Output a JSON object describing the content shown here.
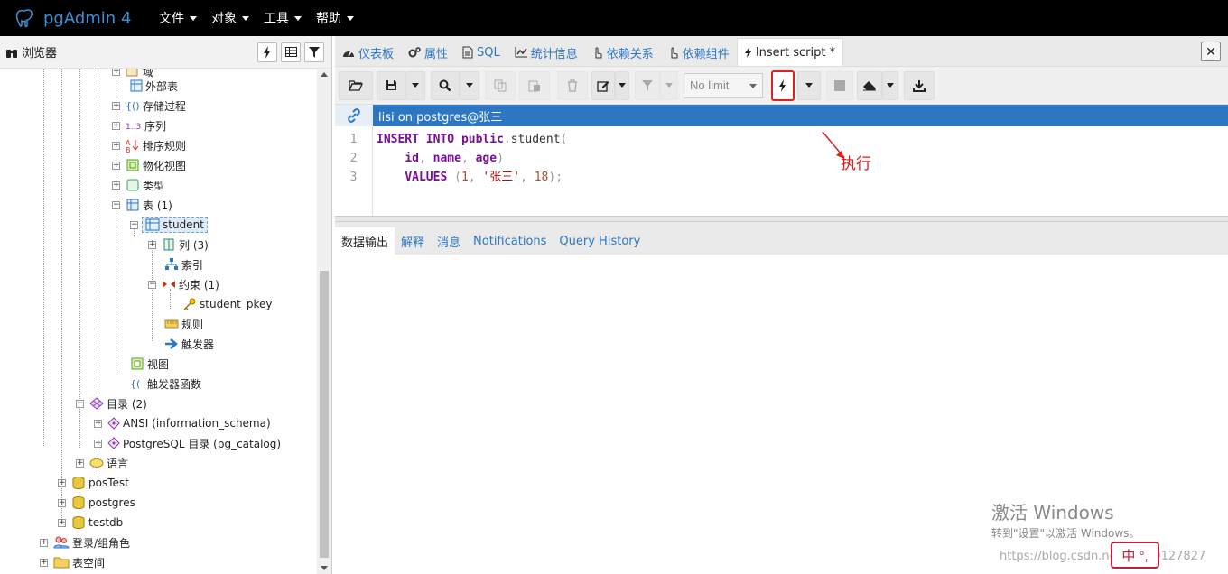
{
  "app": {
    "name": "pgAdmin 4"
  },
  "menu": [
    {
      "label": "文件"
    },
    {
      "label": "对象"
    },
    {
      "label": "工具"
    },
    {
      "label": "帮助"
    }
  ],
  "browser": {
    "title": "浏览器"
  },
  "tree": [
    {
      "label": "域"
    },
    {
      "label": "外部表"
    },
    {
      "label": "存储过程"
    },
    {
      "label": "序列"
    },
    {
      "label": "排序规则"
    },
    {
      "label": "物化视图"
    },
    {
      "label": "类型"
    },
    {
      "label": "表 (1)"
    },
    {
      "label": "student"
    },
    {
      "label": "列 (3)"
    },
    {
      "label": "索引"
    },
    {
      "label": "约束 (1)"
    },
    {
      "label": "student_pkey"
    },
    {
      "label": "规则"
    },
    {
      "label": "触发器"
    },
    {
      "label": "视图"
    },
    {
      "label": "触发器函数"
    },
    {
      "label": "目录 (2)"
    },
    {
      "label": "ANSI (information_schema)"
    },
    {
      "label": "PostgreSQL 目录 (pg_catalog)"
    },
    {
      "label": "语言"
    },
    {
      "label": "posTest"
    },
    {
      "label": "postgres"
    },
    {
      "label": "testdb"
    },
    {
      "label": "登录/组角色"
    },
    {
      "label": "表空间"
    }
  ],
  "tabs": [
    {
      "label": "仪表板"
    },
    {
      "label": "属性"
    },
    {
      "label": "SQL"
    },
    {
      "label": "统计信息"
    },
    {
      "label": "依赖关系"
    },
    {
      "label": "依赖组件"
    },
    {
      "label": "Insert script *"
    }
  ],
  "toolbar": {
    "limit": "No limit"
  },
  "connection": {
    "label": "lisi on postgres@张三"
  },
  "editor": {
    "line_numbers": [
      "1",
      "2",
      "3"
    ],
    "lines": [
      "INSERT INTO public.student(",
      "    id, name, age)",
      "    VALUES (1, '张三', 18);"
    ]
  },
  "annotation": "执行",
  "result_tabs": [
    {
      "label": "数据输出"
    },
    {
      "label": "解释"
    },
    {
      "label": "消息"
    },
    {
      "label": "Notifications"
    },
    {
      "label": "Query History"
    }
  ],
  "watermark": {
    "line1": "激活 Windows",
    "line2": "转到\"设置\"以激活 Windows。",
    "line3": "https://blog.csdn.net/qq_40127827"
  },
  "ime": "中 °,"
}
